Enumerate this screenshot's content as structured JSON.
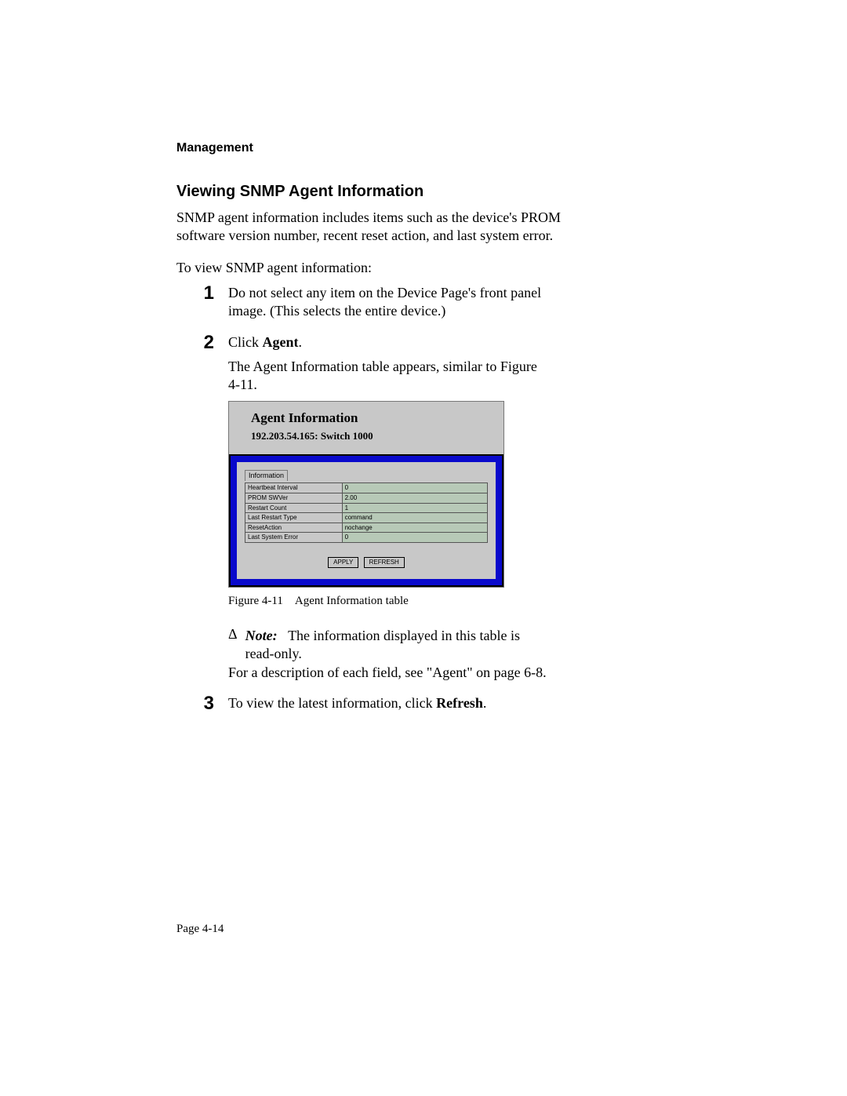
{
  "chapter": "Management",
  "section_title": "Viewing SNMP Agent Information",
  "intro": "SNMP agent information includes items such as the device's PROM software version number, recent reset action, and last system error.",
  "lead": "To view SNMP agent information:",
  "steps": {
    "s1": {
      "num": "1",
      "text": "Do not select any item on the Device Page's front panel image.  (This selects the entire device.)"
    },
    "s2": {
      "num": "2",
      "line1_prefix": "Click ",
      "line1_bold": "Agent",
      "line1_suffix": ".",
      "line2": "The Agent Information table appears, similar to Figure 4-11."
    },
    "s3": {
      "num": "3",
      "prefix": "To view the latest information, click ",
      "bold": "Refresh",
      "suffix": "."
    }
  },
  "figure": {
    "title": "Agent Information",
    "subtitle": "192.203.54.165: Switch 1000",
    "info_label": "Information",
    "rows": [
      {
        "label": "Heartbeat Interval",
        "value": "0"
      },
      {
        "label": "PROM SWVer",
        "value": "2.00"
      },
      {
        "label": "Restart Count",
        "value": "1"
      },
      {
        "label": "Last Restart Type",
        "value": "command"
      },
      {
        "label": "ResetAction",
        "value": "nochange"
      },
      {
        "label": "Last System Error",
        "value": "0"
      }
    ],
    "buttons": {
      "apply": "APPLY",
      "refresh": "REFRESH"
    },
    "caption_label": "Figure 4-11",
    "caption_text": "Agent Information table"
  },
  "note": {
    "symbol": "Δ",
    "label": "Note:",
    "text": "The information displayed in this table is read-only."
  },
  "ref_line": "For a description of each field, see \"Agent\" on page 6-8.",
  "page_number": "Page 4-14"
}
